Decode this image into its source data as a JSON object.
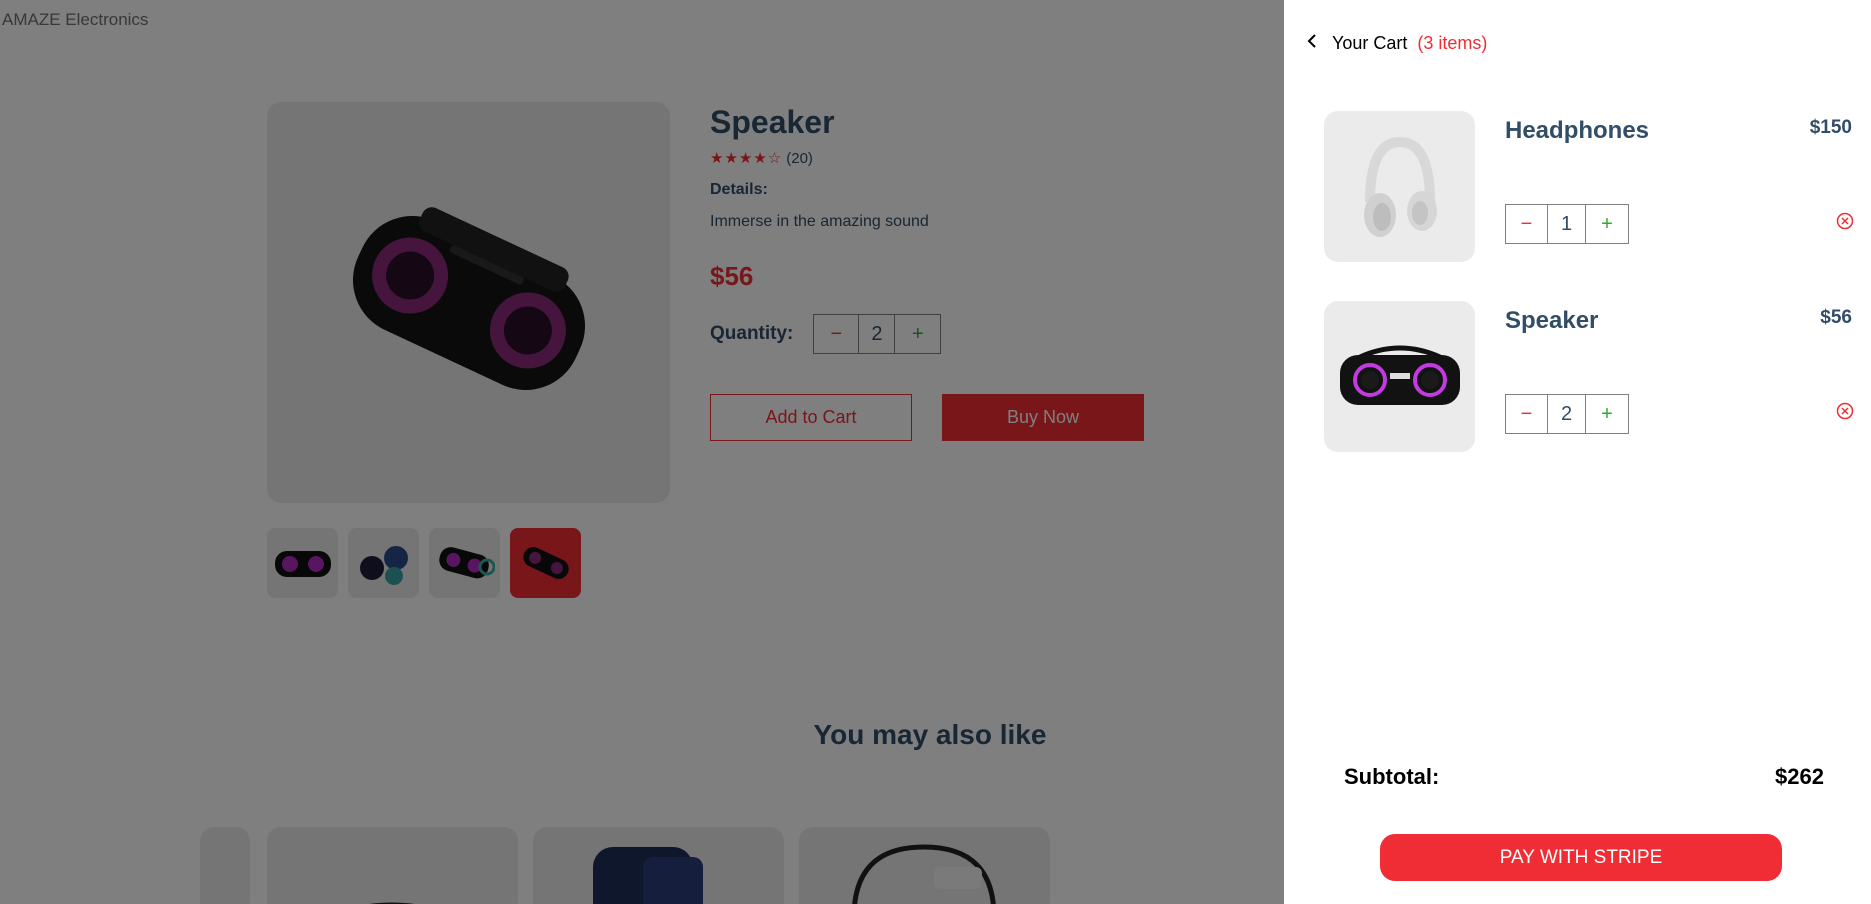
{
  "brand": "AMAZE Electronics",
  "product": {
    "name": "Speaker",
    "stars": "★★★★☆",
    "reviews": "(20)",
    "details_label": "Details:",
    "details_text": "Immerse in the amazing sound",
    "price": "$56",
    "quantity_label": "Quantity:",
    "quantity": "2",
    "minus": "−",
    "plus": "+",
    "add_to_cart": "Add to Cart",
    "buy_now": "Buy Now",
    "rating": 4,
    "rating_max": 5,
    "selected_thumbnail_index": 3
  },
  "related": {
    "title": "You may also like"
  },
  "cart": {
    "title": "Your Cart",
    "count": "(3 items)",
    "back_icon": "chevron-left-icon",
    "items": [
      {
        "name": "Headphones",
        "price": "$150",
        "quantity": "1"
      },
      {
        "name": "Speaker",
        "price": "$56",
        "quantity": "2"
      }
    ],
    "subtotal_label": "Subtotal:",
    "subtotal_value": "$262",
    "pay_button": "PAY WITH STRIPE"
  },
  "colors": {
    "accent": "#f02d34",
    "text": "#324d67",
    "plus": "#31a831",
    "image_bg": "#ebebeb"
  }
}
